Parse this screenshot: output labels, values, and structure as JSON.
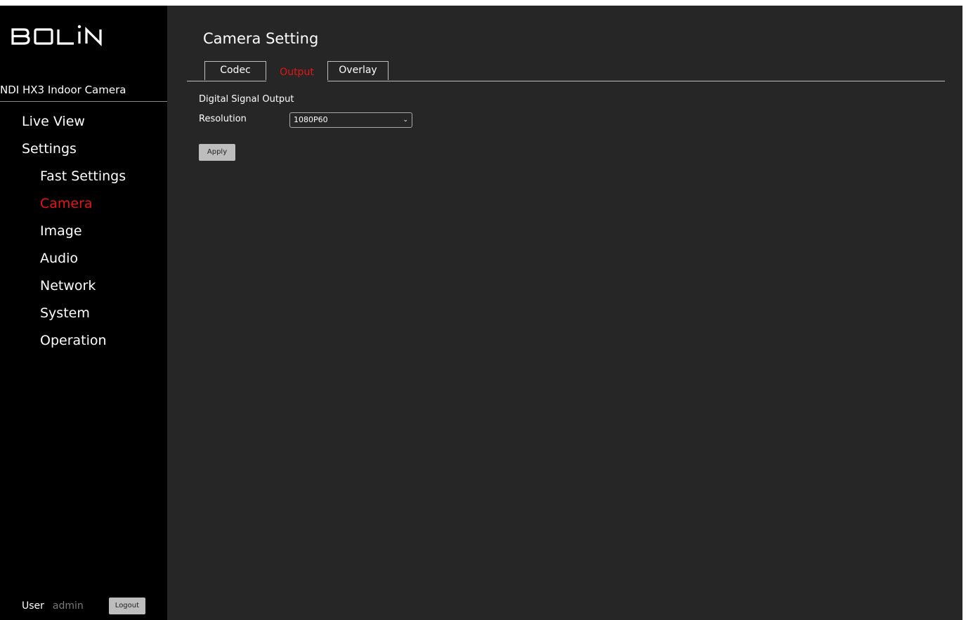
{
  "brand": {
    "logo_text": "BOLIN"
  },
  "sidebar": {
    "device_name": "NDI HX3 Indoor Camera",
    "nav": [
      {
        "label": "Live View",
        "level": "top",
        "active": false
      },
      {
        "label": "Settings",
        "level": "top",
        "active": false
      },
      {
        "label": "Fast Settings",
        "level": "sub",
        "active": false
      },
      {
        "label": "Camera",
        "level": "sub",
        "active": true
      },
      {
        "label": "Image",
        "level": "sub",
        "active": false
      },
      {
        "label": "Audio",
        "level": "sub",
        "active": false
      },
      {
        "label": "Network",
        "level": "sub",
        "active": false
      },
      {
        "label": "System",
        "level": "sub",
        "active": false
      },
      {
        "label": "Operation",
        "level": "sub",
        "active": false
      }
    ],
    "user_label": "User",
    "user_name": "admin",
    "logout_label": "Logout"
  },
  "main": {
    "title": "Camera Setting",
    "tabs": [
      {
        "label": "Codec",
        "active": false
      },
      {
        "label": "Output",
        "active": true
      },
      {
        "label": "Overlay",
        "active": false
      }
    ],
    "section_label": "Digital Signal Output",
    "resolution": {
      "label": "Resolution",
      "value": "1080P60"
    },
    "apply_label": "Apply"
  },
  "colors": {
    "sidebar_bg": "#000000",
    "main_bg": "#262626",
    "active": "#e81414",
    "button_bg": "#bdbdbd"
  }
}
